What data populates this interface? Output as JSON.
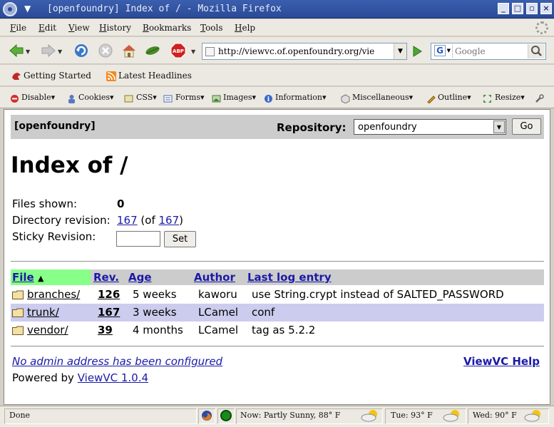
{
  "window": {
    "title": "[openfoundry] Index of / - Mozilla Firefox"
  },
  "menubar": {
    "items": [
      "File",
      "Edit",
      "View",
      "History",
      "Bookmarks",
      "Tools",
      "Help"
    ]
  },
  "navbar": {
    "url": "http://viewvc.of.openfoundry.org/vie",
    "search_placeholder": "Google",
    "search_engine_letter": "G"
  },
  "bookmarks": {
    "items": [
      "Getting Started",
      "Latest Headlines"
    ]
  },
  "devbar": {
    "items": [
      "Disable",
      "Cookies",
      "CSS",
      "Forms",
      "Images",
      "Information",
      "Miscellaneous",
      "Outline",
      "Resize"
    ]
  },
  "viewvc": {
    "project": "[openfoundry]",
    "repository_label": "Repository:",
    "repository_value": "openfoundry",
    "go_label": "Go",
    "page_title": "Index of /",
    "files_shown_label": "Files shown:",
    "files_shown_value": "0",
    "dir_revision_label": "Directory revision:",
    "dir_revision_value": "167",
    "dir_revision_of_prefix": "(of",
    "dir_revision_of_value": "167",
    "dir_revision_of_suffix": ")",
    "sticky_label": "Sticky Revision:",
    "set_label": "Set",
    "columns": [
      "File",
      "Rev.",
      "Age",
      "Author",
      "Last log entry"
    ],
    "sort_indicator": "▲",
    "rows": [
      {
        "file": "branches/",
        "rev": "126",
        "age": "5 weeks",
        "author": "kaworu",
        "log": "use String.crypt instead of SALTED_PASSWORD"
      },
      {
        "file": "trunk/",
        "rev": "167",
        "age": "3 weeks",
        "author": "LCamel",
        "log": "conf"
      },
      {
        "file": "vendor/",
        "rev": "39",
        "age": "4 months",
        "author": "LCamel",
        "log": "tag as 5.2.2"
      }
    ],
    "admin_text": "No admin address has been configured",
    "help_text": "ViewVC Help",
    "powered_prefix": "Powered by",
    "powered_link": "ViewVC 1.0.4"
  },
  "statusbar": {
    "status": "Done",
    "weather_now": "Now: Partly Sunny, 88° F",
    "weather_tue": "Tue: 93° F",
    "weather_wed": "Wed: 90° F"
  },
  "colors": {
    "titlebar": "#2a4a97",
    "link": "#1a1aa8",
    "header_bg": "#cccccc",
    "sorted_col": "#88ff88",
    "alt_row": "#ccccee"
  }
}
